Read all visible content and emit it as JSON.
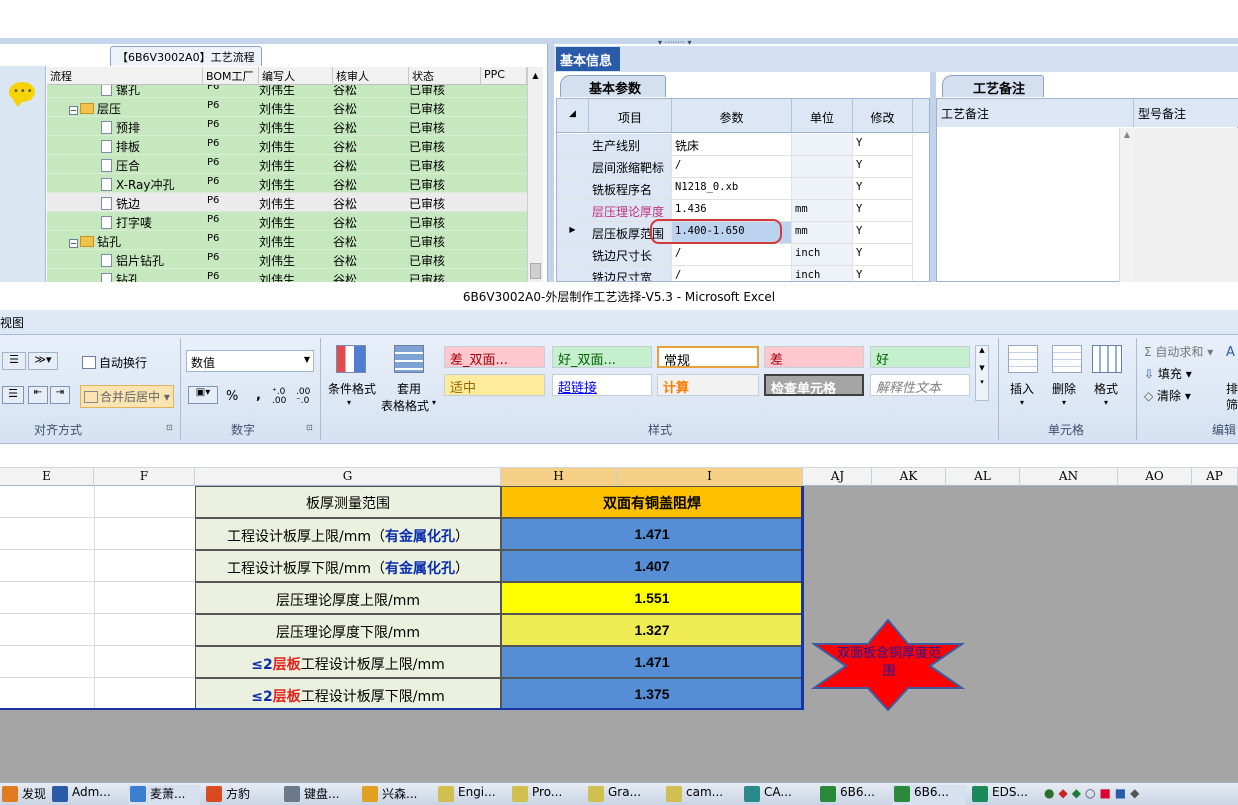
{
  "top": {
    "flow_tab": "【6B6V3002A0】工艺流程",
    "tree_headers": [
      "流程",
      "BOM工厂",
      "编写人",
      "核审人",
      "状态",
      "PPC"
    ],
    "tree_rows": [
      {
        "indent": 3,
        "type": "doc",
        "name": "镙孔",
        "bom": "P6",
        "writer": "刘伟生",
        "auditor": "谷松",
        "status": "已审核"
      },
      {
        "indent": 1,
        "type": "folder",
        "name": "层压",
        "bom": "P6",
        "writer": "刘伟生",
        "auditor": "谷松",
        "status": "已审核"
      },
      {
        "indent": 2,
        "type": "doc",
        "name": "预排",
        "bom": "P6",
        "writer": "刘伟生",
        "auditor": "谷松",
        "status": "已审核"
      },
      {
        "indent": 2,
        "type": "doc",
        "name": "排板",
        "bom": "P6",
        "writer": "刘伟生",
        "auditor": "谷松",
        "status": "已审核"
      },
      {
        "indent": 2,
        "type": "doc",
        "name": "压合",
        "bom": "P6",
        "writer": "刘伟生",
        "auditor": "谷松",
        "status": "已审核"
      },
      {
        "indent": 2,
        "type": "doc",
        "name": "X-Ray冲孔",
        "bom": "P6",
        "writer": "刘伟生",
        "auditor": "谷松",
        "status": "已审核"
      },
      {
        "indent": 2,
        "type": "doc",
        "name": "铣边",
        "bom": "P6",
        "writer": "刘伟生",
        "auditor": "谷松",
        "status": "已审核",
        "selected": true
      },
      {
        "indent": 2,
        "type": "doc",
        "name": "打字唛",
        "bom": "P6",
        "writer": "刘伟生",
        "auditor": "谷松",
        "status": "已审核"
      },
      {
        "indent": 1,
        "type": "folder",
        "name": "钻孔",
        "bom": "P6",
        "writer": "刘伟生",
        "auditor": "谷松",
        "status": "已审核"
      },
      {
        "indent": 2,
        "type": "doc",
        "name": "铝片钻孔",
        "bom": "P6",
        "writer": "刘伟生",
        "auditor": "谷松",
        "status": "已审核"
      },
      {
        "indent": 2,
        "type": "doc",
        "name": "钻孔",
        "bom": "P6",
        "writer": "刘伟生",
        "auditor": "谷松",
        "status": "已审核"
      }
    ],
    "info_tab": "基本信息",
    "param_tab": "基本参数",
    "param_headers": [
      "项目",
      "参数",
      "单位",
      "修改"
    ],
    "param_rows": [
      {
        "item": "生产线别",
        "value": "铣床",
        "unit": "",
        "mod": "Y"
      },
      {
        "item": "层间涨缩靶标",
        "value": "/",
        "unit": "",
        "mod": "Y"
      },
      {
        "item": "铣板程序名",
        "value": "N1218_0.xb",
        "unit": "",
        "mod": "Y"
      },
      {
        "item": "层压理论厚度",
        "value": "1.436",
        "unit": "mm",
        "mod": "Y",
        "pink": true
      },
      {
        "item": "层压板厚范围",
        "value": "1.400-1.650",
        "unit": "mm",
        "mod": "Y",
        "current": true
      },
      {
        "item": "铣边尺寸长",
        "value": "/",
        "unit": "inch",
        "mod": "Y"
      },
      {
        "item": "铣边尺寸宽",
        "value": "/",
        "unit": "inch",
        "mod": "Y"
      }
    ],
    "notes_tab": "工艺备注",
    "notes_h1": "工艺备注",
    "notes_h2": "型号备注"
  },
  "excel_title": "6B6V3002A0-外层制作工艺选择-V5.3 - Microsoft Excel",
  "ribbon": {
    "view_tab": "视图",
    "wrap": "自动换行",
    "merge": "合并后居中",
    "align_label": "对齐方式",
    "number_format": "数值",
    "number_label": "数字",
    "cond_format": "条件格式",
    "table_format1": "套用",
    "table_format2": "表格格式",
    "styles": [
      "差_双面...",
      "好_双面...",
      "常规",
      "差",
      "好",
      "适中",
      "超链接",
      "计算",
      "检查单元格",
      "解释性文本"
    ],
    "styles_label": "样式",
    "insert": "插入",
    "delete": "删除",
    "format": "格式",
    "cells_label": "单元格",
    "autosum": "自动求和",
    "fill": "填充",
    "clear": "清除",
    "sort": "排",
    "filter": "筛",
    "edit_label": "编辑"
  },
  "columns": [
    "E",
    "F",
    "G",
    "H",
    "I",
    "AJ",
    "AK",
    "AL",
    "AN",
    "AO",
    "AP"
  ],
  "table": {
    "header_left": "板厚测量范围",
    "header_right": "双面有铜盖阻焊",
    "rows": [
      {
        "pre": "",
        "pre_red": "",
        "mid": "工程设计板厚上限/mm（",
        "blue": "有金属化孔",
        "post": "）",
        "value": "1.471",
        "color": "#558ed5"
      },
      {
        "pre": "",
        "pre_red": "",
        "mid": "工程设计板厚下限/mm（",
        "blue": "有金属化孔",
        "post": "）",
        "value": "1.407",
        "color": "#558ed5"
      },
      {
        "pre": "",
        "pre_red": "",
        "mid": "层压理论厚度上限/mm",
        "blue": "",
        "post": "",
        "value": "1.551",
        "color": "#ffff00"
      },
      {
        "pre": "",
        "pre_red": "",
        "mid": "层压理论厚度下限/mm",
        "blue": "",
        "post": "",
        "value": "1.327",
        "color": "#eeec52"
      },
      {
        "pre": "≤2",
        "pre_red": "层板",
        "mid": "工程设计板厚上限/mm",
        "blue": "",
        "post": "",
        "value": "1.471",
        "color": "#558ed5"
      },
      {
        "pre": "≤2",
        "pre_red": "层板",
        "mid": "工程设计板厚下限/mm",
        "blue": "",
        "post": "",
        "value": "1.375",
        "color": "#558ed5"
      }
    ]
  },
  "callout": "双面板含铜厚度范围",
  "taskbar": [
    "发现...",
    "Adm...",
    "麦萧...",
    "方豹",
    "键盘...",
    "兴森...",
    "Engi...",
    "Pro...",
    "Gra...",
    "cam...",
    "CA...",
    "6B6...",
    "6B6...",
    "EDS..."
  ],
  "colors": {
    "header_orange": "#ffc000",
    "value_blue": "#558ed5",
    "value_yellow": "#ffff00",
    "tree_green": "#c6e8be",
    "star_red": "#ff0000"
  }
}
